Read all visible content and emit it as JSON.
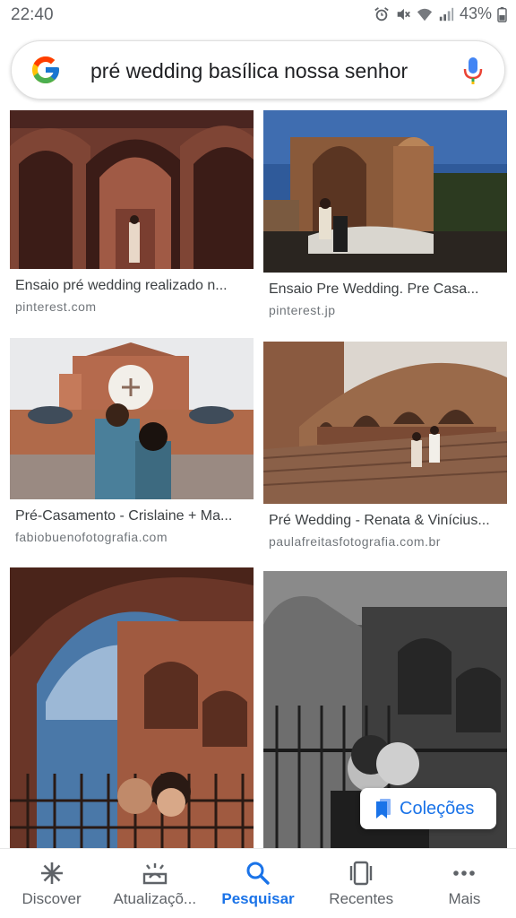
{
  "status": {
    "time": "22:40",
    "battery": "43%"
  },
  "search": {
    "query": "pré wedding basílica nossa senhor"
  },
  "results": [
    {
      "title": "Ensaio pré wedding realizado n...",
      "source": "pinterest.com"
    },
    {
      "title": "Ensaio Pre Wedding. Pre Casa...",
      "source": "pinterest.jp"
    },
    {
      "title": "Pré-Casamento - Crislaine + Ma...",
      "source": "fabiobuenofotografia.com"
    },
    {
      "title": "Pré Wedding - Renata & Vinícius...",
      "source": "paulafreitasfotografia.com.br"
    }
  ],
  "colecoes": {
    "label": "Coleções"
  },
  "nav": [
    {
      "label": "Discover",
      "icon": "asterisk-icon"
    },
    {
      "label": "Atualizaçõ...",
      "icon": "updates-icon"
    },
    {
      "label": "Pesquisar",
      "icon": "search-icon"
    },
    {
      "label": "Recentes",
      "icon": "recent-icon"
    },
    {
      "label": "Mais",
      "icon": "more-icon"
    }
  ],
  "colors": {
    "accent": "#1a73e8",
    "text": "#3c4043",
    "muted": "#70757a"
  }
}
